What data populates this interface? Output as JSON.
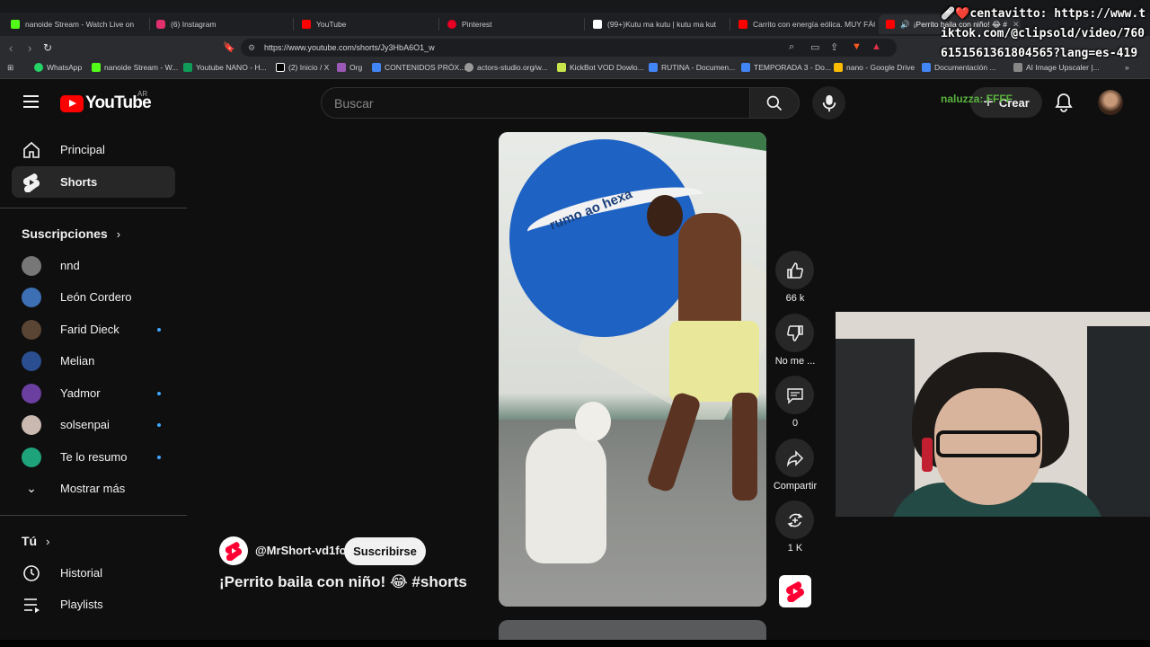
{
  "browser": {
    "tabs": [
      {
        "title": "nanoide Stream - Watch Live on",
        "color": "#53fc18"
      },
      {
        "title": "(6) Instagram",
        "color": "#e1306c"
      },
      {
        "title": "YouTube",
        "color": "#ff0000"
      },
      {
        "title": "Pinterest",
        "color": "#e60023"
      },
      {
        "title": "(99+)Kutu ma kutu | kutu ma kut",
        "color": "#ffffff"
      },
      {
        "title": "Carrito con energía eólica. MUY FÁCI",
        "color": "#ff0000"
      },
      {
        "title": "¡Perrito baila con niño! 😂 #",
        "color": "#ff0000"
      }
    ],
    "url": "https://www.youtube.com/shorts/Jy3HbA6O1_w",
    "bookmarks": [
      {
        "label": "WhatsApp",
        "color": "#25d366"
      },
      {
        "label": "nanoide Stream - W...",
        "color": "#53fc18"
      },
      {
        "label": "Youtube NANO - H...",
        "color": "#0f9d58"
      },
      {
        "label": "(2) Inicio / X",
        "color": "#ffffff"
      },
      {
        "label": "Org",
        "color": "#9b59b6"
      },
      {
        "label": "CONTENIDOS PRÓX...",
        "color": "#4285f4"
      },
      {
        "label": "actors-studio.org/w...",
        "color": "#999999"
      },
      {
        "label": "KickBot VOD Dowlo...",
        "color": "#c8e64c"
      },
      {
        "label": "RUTINA - Documen...",
        "color": "#4285f4"
      },
      {
        "label": "TEMPORADA 3 - Do...",
        "color": "#4285f4"
      },
      {
        "label": "nano - Google Drive",
        "color": "#fbbc04"
      },
      {
        "label": "Documentación ...",
        "color": "#4285f4"
      },
      {
        "label": "AI Image Upscaler |...",
        "color": "#888888"
      }
    ]
  },
  "youtube": {
    "logo_text": "YouTube",
    "region": "AR",
    "search_placeholder": "Buscar",
    "create_label": "Crear",
    "nav": {
      "home": "Principal",
      "shorts": "Shorts"
    },
    "subscriptions_heading": "Suscripciones",
    "subscriptions": [
      {
        "name": "nnd",
        "color": "#777777",
        "new": false
      },
      {
        "name": "León Cordero",
        "color": "#3d6fb5",
        "new": false
      },
      {
        "name": "Farid Dieck",
        "color": "#5a4434",
        "new": true
      },
      {
        "name": "Melian",
        "color": "#2a4e8f",
        "new": false
      },
      {
        "name": "Yadmor",
        "color": "#6a3fa0",
        "new": true
      },
      {
        "name": "solsenpai",
        "color": "#c9b9b0",
        "new": true
      },
      {
        "name": "Te lo resumo",
        "color": "#1fa37a",
        "new": true
      }
    ],
    "show_more": "Mostrar más",
    "you_heading": "Tú",
    "you_items": [
      {
        "label": "Historial"
      },
      {
        "label": "Playlists"
      }
    ]
  },
  "short": {
    "channel": "@MrShort-vd1fc",
    "subscribe_label": "Suscribirse",
    "title": "¡Perrito baila con niño!  😂  #shorts",
    "video_motto": "rumo ao hexa",
    "likes": "66 k",
    "dislike_label": "No me ...",
    "comments": "0",
    "share_label": "Compartir",
    "remix": "1 K"
  },
  "overlay": {
    "clip_text": "🩹❤️centavitto: https://www.tiktok.com/@clipsold/video/7606151561361804565?lang=es-419",
    "user": "naluzza: FFFF"
  }
}
